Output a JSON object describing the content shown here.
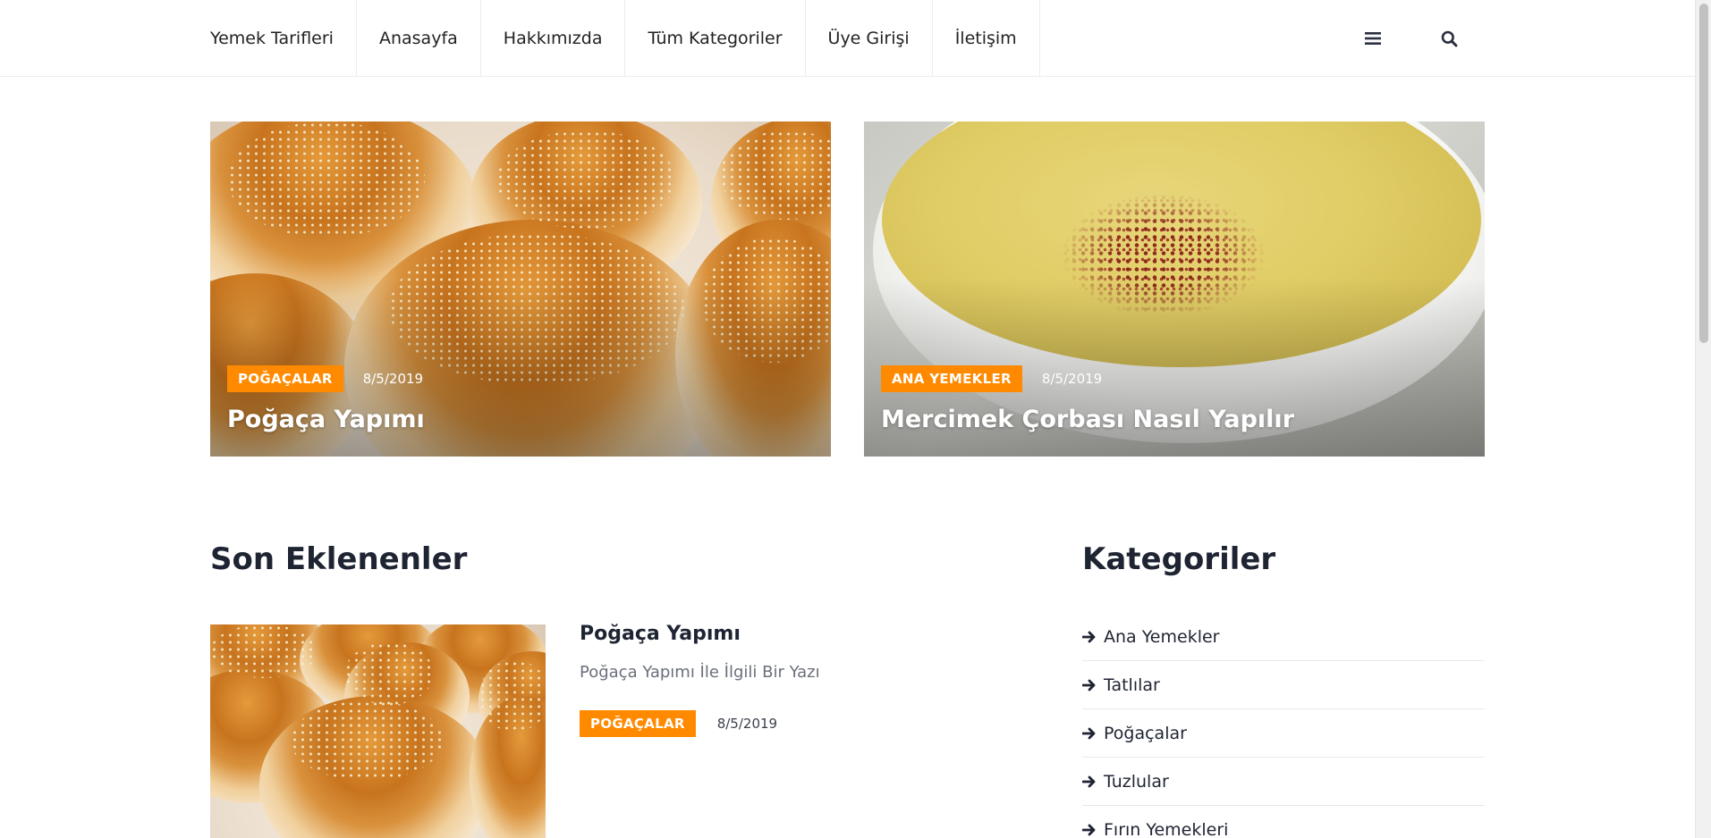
{
  "nav": {
    "brand": "Yemek Tarifleri",
    "items": [
      {
        "label": "Anasayfa"
      },
      {
        "label": "Hakkımızda"
      },
      {
        "label": "Tüm Kategoriler"
      },
      {
        "label": "Üye Girişi"
      },
      {
        "label": "İletişim"
      }
    ],
    "icons": [
      "bars-icon",
      "search-icon"
    ]
  },
  "featured": [
    {
      "category": "POĞAÇALAR",
      "date": "8/5/2019",
      "title": "Poğaça Yapımı",
      "image": "pogaca-photo"
    },
    {
      "category": "ANA YEMEKLER",
      "date": "8/5/2019",
      "title": "Mercimek Çorbası Nasıl Yapılır",
      "image": "lentil-soup-photo"
    }
  ],
  "latest": {
    "heading": "Son Eklenenler",
    "posts": [
      {
        "title": "Poğaça Yapımı",
        "excerpt": "Poğaça Yapımı İle İlgili Bir Yazı",
        "category": "POĞAÇALAR",
        "date": "8/5/2019",
        "image": "pogaca-photo"
      }
    ]
  },
  "categories": {
    "heading": "Kategoriler",
    "items": [
      {
        "label": "Ana Yemekler"
      },
      {
        "label": "Tatlılar"
      },
      {
        "label": "Poğaçalar"
      },
      {
        "label": "Tuzlular"
      },
      {
        "label": "Fırın Yemekleri"
      }
    ]
  },
  "colors": {
    "accent": "#ff8a00",
    "text": "#1f2433",
    "muted": "#6a6f7a"
  }
}
